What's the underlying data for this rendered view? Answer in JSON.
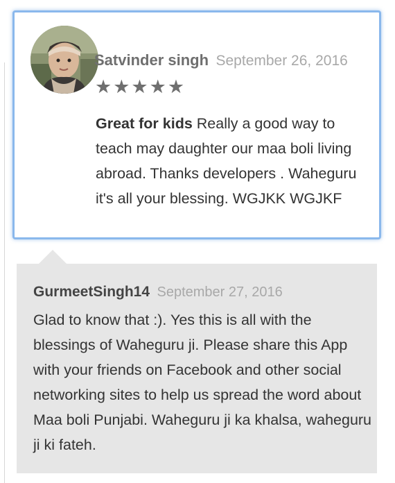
{
  "review": {
    "author": "Satvinder singh",
    "date": "September 26, 2016",
    "rating": 5,
    "stars": "★★★★★",
    "title": "Great for kids",
    "text": "Really a good way to teach may daughter our maa boli living abroad. Thanks developers . Waheguru it's all your blessing. WGJKK WGJKF"
  },
  "reply": {
    "author": "GurmeetSingh14",
    "date": "September 27, 2016",
    "text": "Glad to know that :). Yes this is all with the blessings of Waheguru ji. Please share this App with your friends on Facebook and other social networking sites to help us spread the word about Maa boli Punjabi. Waheguru ji ka khalsa, waheguru ji ki fateh."
  },
  "colors": {
    "highlight_border": "#8ab8ec",
    "reply_background": "#e6e6e6",
    "star_color": "#6f6f6f"
  }
}
